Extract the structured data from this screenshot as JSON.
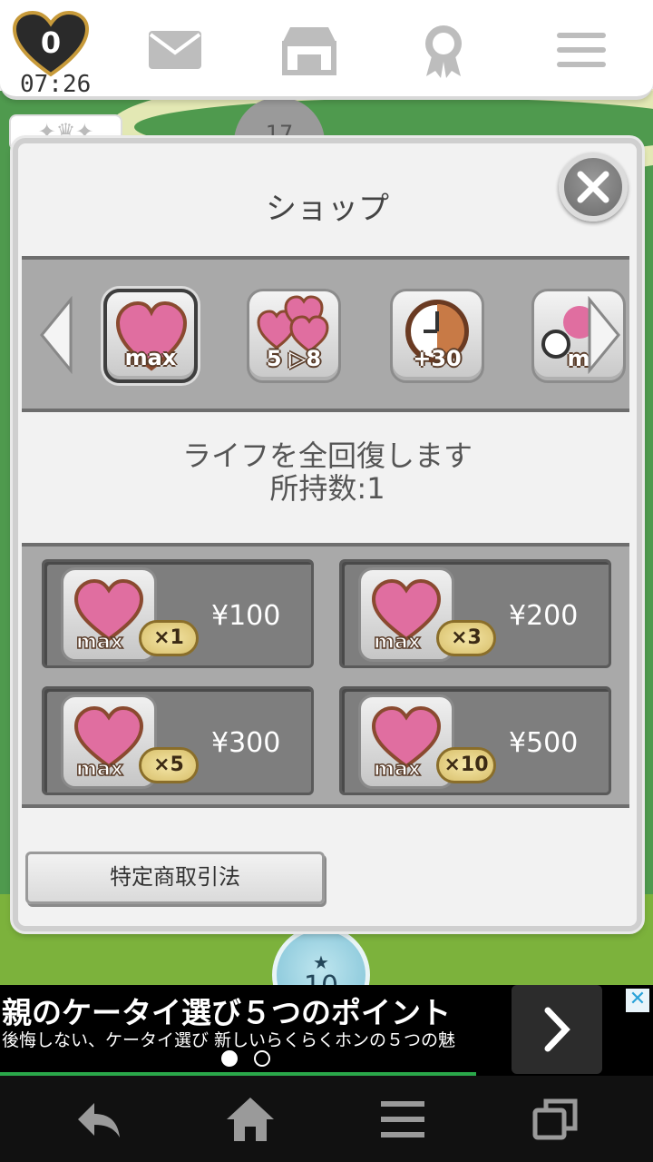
{
  "topbar": {
    "life_count": "0",
    "life_timer": "07:26",
    "icons": [
      "mail-icon",
      "shop-icon",
      "award-icon",
      "menu-icon"
    ]
  },
  "map": {
    "stage_top": "17",
    "stage_bottom": "10",
    "stage_bottom_star": "★"
  },
  "modal": {
    "title": "ショップ",
    "items": [
      {
        "label": "max",
        "icon": "heart-max-icon",
        "selected": true
      },
      {
        "label": "5 ▷8",
        "icon": "hearts-5-to-8-icon",
        "selected": false
      },
      {
        "label": "+30",
        "icon": "clock-plus-30-icon",
        "selected": false
      },
      {
        "label": "m",
        "icon": "partial-item-icon",
        "selected": false
      }
    ],
    "description_line1": "ライフを全回復します",
    "description_line2": "所持数:1",
    "packs": [
      {
        "icon_label": "max",
        "qty": "×1",
        "price": "¥100"
      },
      {
        "icon_label": "max",
        "qty": "×3",
        "price": "¥200"
      },
      {
        "icon_label": "max",
        "qty": "×5",
        "price": "¥300"
      },
      {
        "icon_label": "max",
        "qty": "×10",
        "price": "¥500"
      }
    ],
    "legal_button": "特定商取引法"
  },
  "ad": {
    "title": "親のケータイ選び５つのポイント",
    "subtitle": "後悔しない、ケータイ選び 新しいらくらくホンの５つの魅",
    "close_glyph": "✕"
  },
  "colors": {
    "heart_pink": "#e06ea0",
    "panel_gray": "#a9a9a9",
    "pack_gray": "#7e7e7e",
    "coin_gold": "#d8bf6a"
  }
}
